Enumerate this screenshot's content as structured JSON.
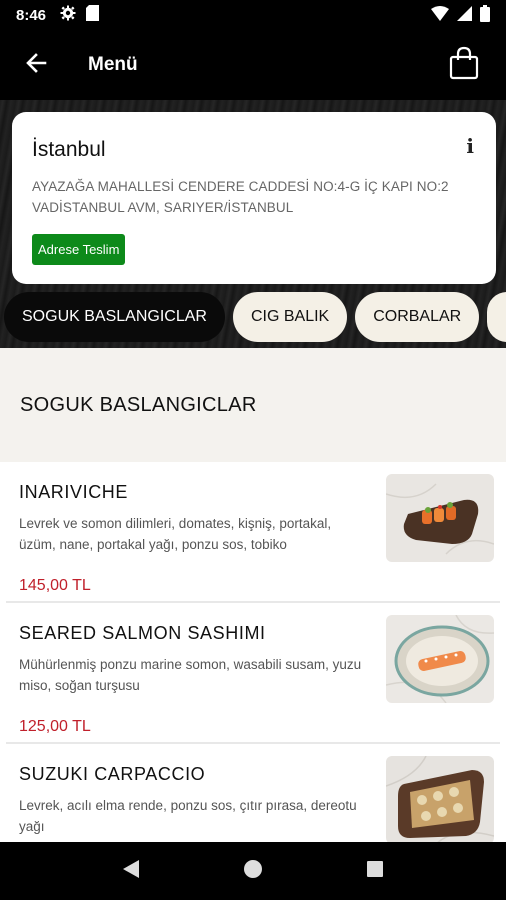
{
  "status_bar": {
    "time": "8:46"
  },
  "app_bar": {
    "title": "Menü"
  },
  "address": {
    "city": "İstanbul",
    "line": "AYAZAĞA MAHALLESİ CENDERE CADDESİ NO:4-G İÇ KAPI NO:2 VADİSTANBUL AVM, SARIYER/İSTANBUL",
    "delivery_label": "Adrese Teslim",
    "info_symbol": "i"
  },
  "tabs": [
    {
      "label": "SOGUK BASLANGICLAR"
    },
    {
      "label": "CIG BALIK"
    },
    {
      "label": "CORBALAR"
    }
  ],
  "section": {
    "title": "SOGUK BASLANGICLAR"
  },
  "items": [
    {
      "name": "INARIVICHE",
      "description": "Levrek ve somon dilimleri, domates, kişniş, portakal, üzüm, nane, portakal yağı, ponzu sos, tobiko",
      "price": "145,00 TL"
    },
    {
      "name": "SEARED SALMON SASHIMI",
      "description": "Mühürlenmiş ponzu marine somon, wasabili susam, yuzu miso, soğan turşusu",
      "price": "125,00 TL"
    },
    {
      "name": "SUZUKI CARPACCIO",
      "description": "Levrek, acılı elma rende, ponzu sos, çıtır pırasa, dereotu yağı",
      "price": ""
    }
  ],
  "colors": {
    "accent_price": "#c0202b",
    "delivery_badge": "#0d8a1a",
    "tab_active": "#0a0a0a",
    "tab_inactive": "#f4f0e6"
  },
  "icons": [
    "settings-icon",
    "sd-card-icon",
    "wifi-icon",
    "signal-icon",
    "battery-icon",
    "back-arrow-icon",
    "shopping-bag-icon",
    "info-icon",
    "nav-back-icon",
    "nav-home-icon",
    "nav-recents-icon"
  ]
}
